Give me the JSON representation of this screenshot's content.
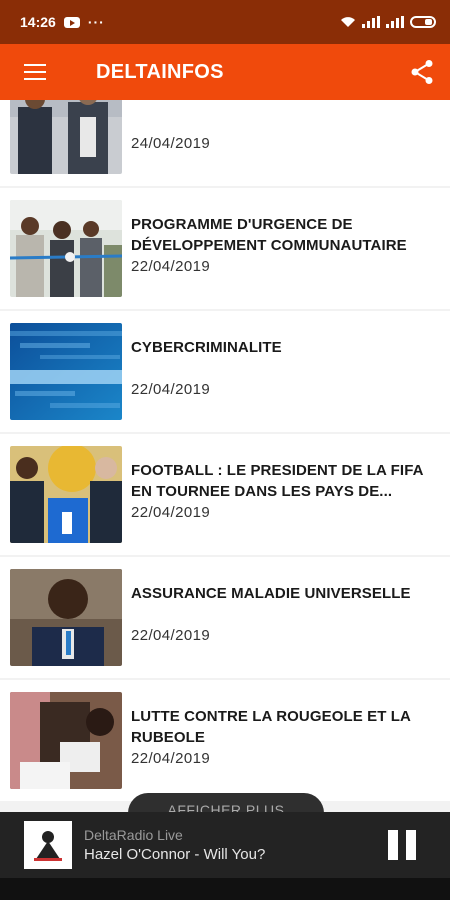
{
  "status_bar": {
    "time": "14:26",
    "dots": "···"
  },
  "app_bar": {
    "title": "DELTAINFOS"
  },
  "articles": [
    {
      "title": "",
      "date": "24/04/2019"
    },
    {
      "title": "PROGRAMME D'URGENCE DE DÉVELOPPEMENT COMMUNAUTAIRE",
      "date": "22/04/2019"
    },
    {
      "title": "CYBERCRIMINALITE",
      "date": "22/04/2019"
    },
    {
      "title": "FOOTBALL : LE PRESIDENT DE LA FIFA EN TOURNEE DANS LES PAYS DE...",
      "date": "22/04/2019"
    },
    {
      "title": "ASSURANCE MALADIE UNIVERSELLE",
      "date": "22/04/2019"
    },
    {
      "title": "LUTTE CONTRE LA ROUGEOLE ET LA RUBEOLE",
      "date": "22/04/2019"
    }
  ],
  "more_button": {
    "label": "AFFICHER PLUS"
  },
  "player": {
    "station": "DeltaRadio Live",
    "track": "Hazel O'Connor - Will You?"
  },
  "colors": {
    "status_bar": "#8a2d06",
    "app_bar": "#f04a0c",
    "player": "#232323"
  }
}
